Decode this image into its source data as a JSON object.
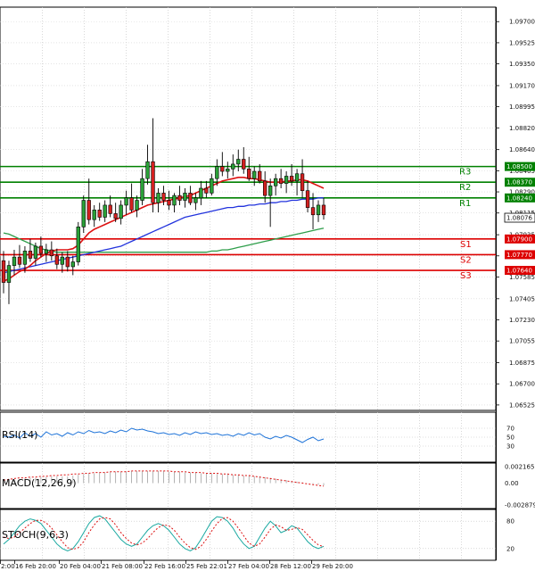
{
  "chart_data": {
    "type": "candlestick",
    "price_scale": {
      "range": [
        1.0648,
        1.0982
      ],
      "ticks": [
        "1.09700",
        "1.09525",
        "1.09350",
        "1.09170",
        "1.08995",
        "1.08820",
        "1.08640",
        "1.08465",
        "1.08290",
        "1.08115",
        "1.07935",
        "1.07760",
        "1.07585",
        "1.07405",
        "1.07230",
        "1.07055",
        "1.06875",
        "1.06700",
        "1.06525"
      ]
    },
    "time_labels": [
      "2:00",
      "16 Feb 20:00",
      "20 Feb 04:00",
      "21 Feb 08:00",
      "22 Feb 16:00",
      "25 Feb 22:01",
      "27 Feb 04:00",
      "28 Feb 12:00",
      "29 Feb 20:00"
    ],
    "current_price": "1.08076",
    "levels": [
      {
        "name": "R3",
        "value": 1.085,
        "text": "1.08500",
        "color": "#008000"
      },
      {
        "name": "R2",
        "value": 1.0837,
        "text": "1.08370",
        "color": "#008000"
      },
      {
        "name": "R1",
        "value": 1.0824,
        "text": "1.08240",
        "color": "#008000"
      },
      {
        "name": "S1",
        "value": 1.079,
        "text": "1.07900",
        "color": "#dd0000"
      },
      {
        "name": "S2",
        "value": 1.0777,
        "text": "1.07770",
        "color": "#dd0000"
      },
      {
        "name": "S3",
        "value": 1.0764,
        "text": "1.07640",
        "color": "#dd0000"
      }
    ],
    "candles": [
      [
        1.0772,
        1.078,
        1.0745,
        1.0754
      ],
      [
        1.0754,
        1.0772,
        1.0736,
        1.0768
      ],
      [
        1.0768,
        1.0781,
        1.076,
        1.0775
      ],
      [
        1.0775,
        1.0785,
        1.0766,
        1.0769
      ],
      [
        1.0769,
        1.0784,
        1.0762,
        1.078
      ],
      [
        1.078,
        1.079,
        1.0771,
        1.0774
      ],
      [
        1.0774,
        1.0787,
        1.0768,
        1.0784
      ],
      [
        1.0784,
        1.0792,
        1.0775,
        1.0778
      ],
      [
        1.0778,
        1.0786,
        1.0771,
        1.0781
      ],
      [
        1.0781,
        1.0788,
        1.0772,
        1.0776
      ],
      [
        1.0776,
        1.0782,
        1.0765,
        1.0769
      ],
      [
        1.0769,
        1.0779,
        1.0762,
        1.0775
      ],
      [
        1.0775,
        1.078,
        1.0763,
        1.0767
      ],
      [
        1.0767,
        1.0776,
        1.076,
        1.0771
      ],
      [
        1.0771,
        1.0804,
        1.0768,
        1.08
      ],
      [
        1.08,
        1.0826,
        1.0795,
        1.0822
      ],
      [
        1.0822,
        1.084,
        1.0802,
        1.0806
      ],
      [
        1.0806,
        1.0818,
        1.08,
        1.0814
      ],
      [
        1.0814,
        1.082,
        1.0805,
        1.0808
      ],
      [
        1.0808,
        1.0822,
        1.0804,
        1.0818
      ],
      [
        1.0818,
        1.0826,
        1.0808,
        1.0811
      ],
      [
        1.0811,
        1.082,
        1.0804,
        1.0807
      ],
      [
        1.0807,
        1.0822,
        1.0802,
        1.0818
      ],
      [
        1.0818,
        1.083,
        1.081,
        1.0824
      ],
      [
        1.0824,
        1.0836,
        1.0812,
        1.0814
      ],
      [
        1.0814,
        1.0826,
        1.0808,
        1.0822
      ],
      [
        1.0822,
        1.0848,
        1.0818,
        1.084
      ],
      [
        1.084,
        1.0868,
        1.0835,
        1.0854
      ],
      [
        1.0854,
        1.089,
        1.0812,
        1.082
      ],
      [
        1.082,
        1.0832,
        1.0812,
        1.0828
      ],
      [
        1.0828,
        1.0834,
        1.0818,
        1.0822
      ],
      [
        1.0822,
        1.083,
        1.0814,
        1.0818
      ],
      [
        1.0818,
        1.0828,
        1.0812,
        1.0826
      ],
      [
        1.0826,
        1.0834,
        1.0818,
        1.0822
      ],
      [
        1.0822,
        1.0832,
        1.0816,
        1.0828
      ],
      [
        1.0828,
        1.0834,
        1.0818,
        1.082
      ],
      [
        1.082,
        1.0828,
        1.0814,
        1.0824
      ],
      [
        1.0824,
        1.0838,
        1.0818,
        1.0832
      ],
      [
        1.0832,
        1.0838,
        1.0824,
        1.0828
      ],
      [
        1.0828,
        1.0844,
        1.0826,
        1.084
      ],
      [
        1.084,
        1.0856,
        1.0834,
        1.085
      ],
      [
        1.085,
        1.0862,
        1.0842,
        1.0846
      ],
      [
        1.0846,
        1.0854,
        1.084,
        1.0848
      ],
      [
        1.0848,
        1.086,
        1.0842,
        1.0852
      ],
      [
        1.0852,
        1.0864,
        1.0846,
        1.0856
      ],
      [
        1.0856,
        1.0866,
        1.0844,
        1.0848
      ],
      [
        1.0848,
        1.0858,
        1.0838,
        1.084
      ],
      [
        1.084,
        1.085,
        1.0834,
        1.0846
      ],
      [
        1.0846,
        1.0852,
        1.0836,
        1.0838
      ],
      [
        1.0838,
        1.0846,
        1.082,
        1.0826
      ],
      [
        1.0826,
        1.084,
        1.08,
        1.0834
      ],
      [
        1.0834,
        1.0844,
        1.0826,
        1.084
      ],
      [
        1.084,
        1.0848,
        1.0832,
        1.0836
      ],
      [
        1.0836,
        1.0846,
        1.0828,
        1.0842
      ],
      [
        1.0842,
        1.0852,
        1.0834,
        1.0838
      ],
      [
        1.0838,
        1.0848,
        1.0826,
        1.0844
      ],
      [
        1.0844,
        1.0856,
        1.0824,
        1.083
      ],
      [
        1.083,
        1.0838,
        1.0812,
        1.0816
      ],
      [
        1.0816,
        1.0828,
        1.0798,
        1.081
      ],
      [
        1.081,
        1.0822,
        1.0804,
        1.0818
      ],
      [
        1.0818,
        1.0824,
        1.0806,
        1.081
      ]
    ],
    "ma_red": [
      1.0755,
      1.0757,
      1.076,
      1.0763,
      1.0765,
      1.0768,
      1.0772,
      1.0775,
      1.0778,
      1.078,
      1.0781,
      1.0781,
      1.0781,
      1.0782,
      1.0785,
      1.079,
      1.0795,
      1.0798,
      1.08,
      1.0802,
      1.0804,
      1.0806,
      1.0808,
      1.081,
      1.0812,
      1.0814,
      1.0816,
      1.0818,
      1.0819,
      1.082,
      1.0821,
      1.0822,
      1.0823,
      1.0824,
      1.0825,
      1.0826,
      1.0828,
      1.083,
      1.0832,
      1.0834,
      1.0836,
      1.0838,
      1.0839,
      1.084,
      1.0841,
      1.0841,
      1.084,
      1.084,
      1.0839,
      1.0838,
      1.0837,
      1.0837,
      1.0837,
      1.0838,
      1.0838,
      1.0839,
      1.0839,
      1.0838,
      1.0836,
      1.0834,
      1.0832
    ],
    "ma_blue": [
      1.0762,
      1.0763,
      1.0764,
      1.0765,
      1.0766,
      1.0767,
      1.0768,
      1.0769,
      1.077,
      1.0771,
      1.0772,
      1.0773,
      1.0774,
      1.0775,
      1.0776,
      1.0777,
      1.0778,
      1.0779,
      1.078,
      1.0781,
      1.0782,
      1.0783,
      1.0784,
      1.0786,
      1.0788,
      1.079,
      1.0792,
      1.0794,
      1.0796,
      1.0798,
      1.08,
      1.0802,
      1.0804,
      1.0806,
      1.0808,
      1.0809,
      1.081,
      1.0811,
      1.0812,
      1.0813,
      1.0814,
      1.0815,
      1.0816,
      1.0816,
      1.0817,
      1.0817,
      1.0818,
      1.0818,
      1.0819,
      1.0819,
      1.082,
      1.082,
      1.0821,
      1.0821,
      1.0822,
      1.0822,
      1.0823,
      1.0823,
      1.0823,
      1.0824,
      1.0824
    ],
    "ma_green": [
      1.0795,
      1.0794,
      1.0792,
      1.079,
      1.0788,
      1.0786,
      1.0784,
      1.0782,
      1.0781,
      1.078,
      1.0779,
      1.0779,
      1.0779,
      1.0779,
      1.0779,
      1.0779,
      1.0779,
      1.0779,
      1.0779,
      1.0779,
      1.0779,
      1.0779,
      1.0779,
      1.0779,
      1.0779,
      1.0779,
      1.0779,
      1.0779,
      1.0779,
      1.0779,
      1.0779,
      1.0779,
      1.0779,
      1.0779,
      1.0779,
      1.0779,
      1.0779,
      1.0779,
      1.0779,
      1.078,
      1.078,
      1.0781,
      1.0781,
      1.0782,
      1.0783,
      1.0784,
      1.0785,
      1.0786,
      1.0787,
      1.0788,
      1.0789,
      1.079,
      1.0791,
      1.0792,
      1.0793,
      1.0794,
      1.0795,
      1.0796,
      1.0797,
      1.0798,
      1.0799
    ],
    "rsi": {
      "label": "RSI(14)",
      "ticks": [
        "70",
        "50",
        "30"
      ],
      "range": [
        0,
        100
      ],
      "values": [
        52,
        50,
        55,
        48,
        60,
        52,
        58,
        50,
        62,
        55,
        58,
        52,
        60,
        55,
        62,
        58,
        65,
        60,
        62,
        58,
        64,
        60,
        66,
        62,
        70,
        66,
        68,
        64,
        62,
        58,
        60,
        56,
        58,
        54,
        60,
        56,
        62,
        58,
        60,
        56,
        58,
        54,
        56,
        52,
        58,
        54,
        60,
        55,
        58,
        50,
        46,
        52,
        48,
        54,
        50,
        44,
        38,
        45,
        50,
        42,
        46
      ]
    },
    "macd": {
      "label": "MACD(12,26,9)",
      "ticks": [
        "0.002165",
        "0.00",
        "-0.002879"
      ],
      "range": [
        -0.003,
        0.0023
      ],
      "hist": [
        0.0002,
        0.0003,
        0.0004,
        0.0005,
        0.0006,
        0.0007,
        0.0007,
        0.0008,
        0.0008,
        0.0009,
        0.0009,
        0.0009,
        0.0009,
        0.001,
        0.0011,
        0.0012,
        0.0013,
        0.0013,
        0.0014,
        0.0014,
        0.0015,
        0.0015,
        0.0015,
        0.0015,
        0.0016,
        0.0016,
        0.0016,
        0.0016,
        0.0016,
        0.0016,
        0.0016,
        0.0015,
        0.0015,
        0.0015,
        0.0014,
        0.0014,
        0.0014,
        0.0013,
        0.0013,
        0.0013,
        0.0012,
        0.0012,
        0.0012,
        0.0011,
        0.0011,
        0.001,
        0.001,
        0.0009,
        0.0009,
        0.0008,
        0.0007,
        0.0006,
        0.0005,
        0.0004,
        0.0003,
        0.0002,
        0.0001,
        0.0,
        -0.0001,
        -0.0002,
        -0.0003
      ],
      "signal": [
        0.0004,
        0.0005,
        0.0006,
        0.0007,
        0.0007,
        0.0008,
        0.0008,
        0.0009,
        0.0009,
        0.001,
        0.001,
        0.0011,
        0.0011,
        0.0012,
        0.0012,
        0.0013,
        0.0013,
        0.0014,
        0.0014,
        0.0014,
        0.0015,
        0.0015,
        0.0015,
        0.0015,
        0.0016,
        0.0016,
        0.0016,
        0.0016,
        0.0016,
        0.0016,
        0.0016,
        0.0016,
        0.0015,
        0.0015,
        0.0015,
        0.0014,
        0.0014,
        0.0014,
        0.0013,
        0.0013,
        0.0013,
        0.0012,
        0.0012,
        0.0011,
        0.0011,
        0.001,
        0.001,
        0.0009,
        0.0008,
        0.0007,
        0.0006,
        0.0005,
        0.0004,
        0.0003,
        0.0002,
        0.0001,
        0.0,
        -0.0001,
        -0.0002,
        -0.0003,
        -0.0004
      ]
    },
    "stoch": {
      "label": "STOCH(9,6,3)",
      "ticks": [
        "80",
        "20"
      ],
      "range": [
        0,
        100
      ],
      "main": [
        30,
        40,
        55,
        70,
        80,
        85,
        82,
        75,
        60,
        45,
        30,
        20,
        15,
        20,
        35,
        55,
        75,
        88,
        92,
        85,
        70,
        55,
        40,
        30,
        25,
        30,
        45,
        60,
        70,
        75,
        70,
        60,
        45,
        30,
        20,
        15,
        22,
        40,
        60,
        80,
        90,
        88,
        80,
        65,
        45,
        30,
        20,
        25,
        45,
        65,
        80,
        70,
        55,
        60,
        70,
        65,
        50,
        35,
        25,
        20,
        25
      ],
      "signal": [
        45,
        42,
        45,
        55,
        65,
        75,
        82,
        82,
        76,
        65,
        50,
        35,
        22,
        18,
        22,
        35,
        55,
        72,
        85,
        88,
        85,
        72,
        55,
        42,
        32,
        28,
        32,
        42,
        55,
        66,
        72,
        70,
        60,
        45,
        32,
        22,
        18,
        25,
        40,
        58,
        75,
        86,
        88,
        80,
        65,
        48,
        32,
        25,
        30,
        45,
        62,
        72,
        68,
        60,
        62,
        66,
        62,
        50,
        38,
        28,
        24
      ]
    }
  }
}
